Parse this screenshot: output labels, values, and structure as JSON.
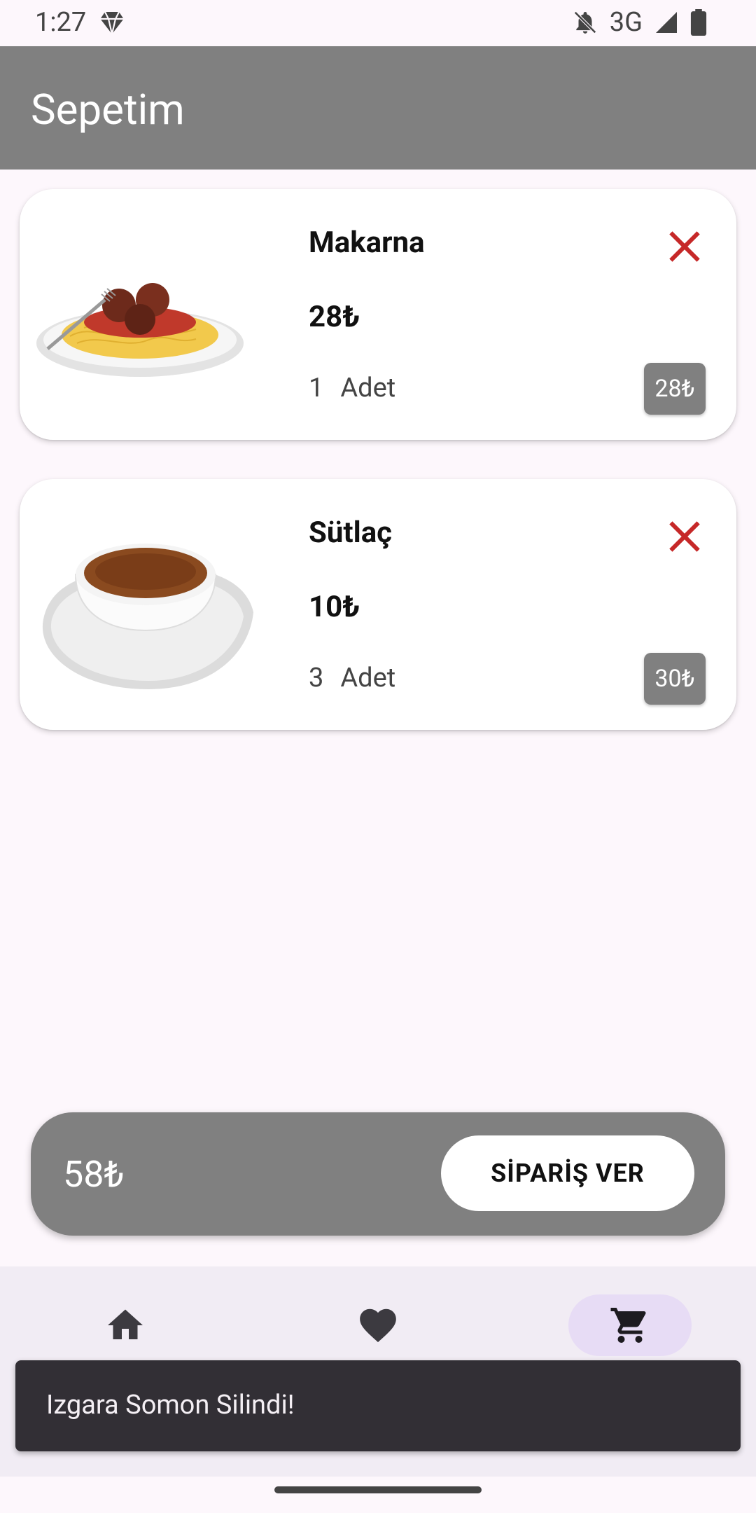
{
  "status_bar": {
    "time": "1:27",
    "network": "3G"
  },
  "app_bar": {
    "title": "Sepetim"
  },
  "cart": {
    "items": [
      {
        "name": "Makarna",
        "price": "28₺",
        "quantity": "1",
        "unit": "Adet",
        "total": "28₺",
        "image_icon": "spaghetti-plate"
      },
      {
        "name": "Sütlaç",
        "price": "10₺",
        "quantity": "3",
        "unit": "Adet",
        "total": "30₺",
        "image_icon": "rice-pudding-bowl"
      }
    ]
  },
  "summary": {
    "total": "58₺",
    "order_label": "SİPARİŞ VER"
  },
  "bottom_nav": {
    "items": [
      {
        "icon": "home-icon",
        "active": false
      },
      {
        "icon": "heart-icon",
        "active": false
      },
      {
        "icon": "cart-icon",
        "active": true
      }
    ]
  },
  "snackbar": {
    "message": "Izgara Somon Silindi!"
  },
  "colors": {
    "app_bar": "#808080",
    "remove_icon": "#c62828",
    "background": "#fdf7fc",
    "snackbar": "#322f35",
    "nav_active": "#e7dcf5"
  }
}
